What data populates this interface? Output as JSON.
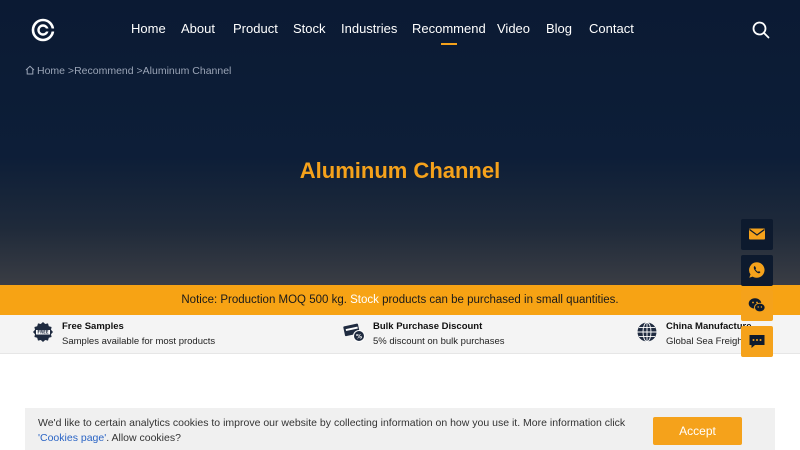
{
  "nav": {
    "items": [
      "Home",
      "About",
      "Product",
      "Stock",
      "Industries",
      "Recommend",
      "Video",
      "Blog",
      "Contact"
    ],
    "active_index": 5
  },
  "breadcrumb": {
    "home": "Home",
    "sep1": " >",
    "recommend": "Recommend",
    "sep2": " >",
    "current": "Aluminum Channel"
  },
  "hero": {
    "title": "Aluminum Channel"
  },
  "notice": {
    "before": "Notice: Production MOQ 500 kg. ",
    "highlight": "Stock",
    "after": " products can be purchased in small quantities."
  },
  "features": [
    {
      "title": "Free Samples",
      "desc": "Samples available for most products",
      "icon": "free-badge-icon"
    },
    {
      "title": "Bulk Purchase Discount",
      "desc": "5% discount on bulk purchases",
      "icon": "discount-card-icon"
    },
    {
      "title": "China Manufacture",
      "desc": "Global Sea Freight Se",
      "icon": "globe-icon"
    }
  ],
  "side_buttons": [
    "email-icon",
    "whatsapp-icon",
    "wechat-icon",
    "chat-icon"
  ],
  "cookie": {
    "text_before": "We'd like to certain analytics cookies to improve our website by collecting information on how you use it. More information click ",
    "link": "'Cookies page'",
    "text_after": ". Allow cookies?",
    "accept_label": "Accept"
  },
  "colors": {
    "accent": "#f5a21b",
    "navy": "#0b1a33",
    "link": "#2a64c5"
  }
}
